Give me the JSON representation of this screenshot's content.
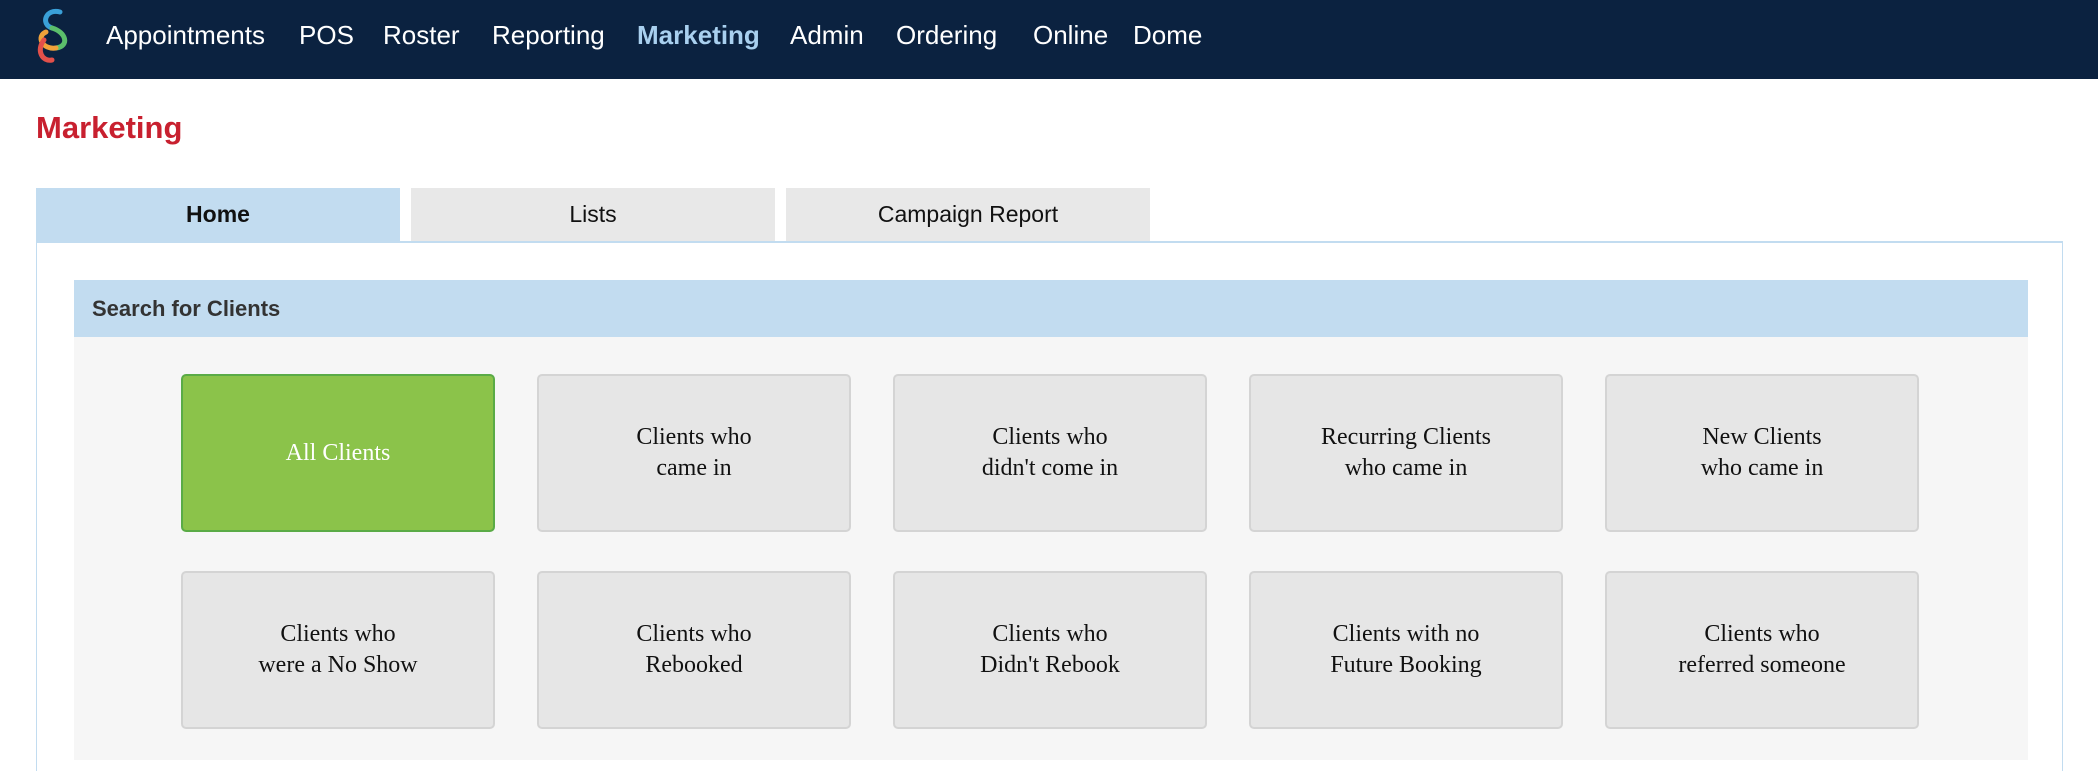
{
  "nav": {
    "items": [
      {
        "label": "Appointments"
      },
      {
        "label": "POS"
      },
      {
        "label": "Roster"
      },
      {
        "label": "Reporting"
      },
      {
        "label": "Marketing",
        "active": true
      },
      {
        "label": "Admin"
      },
      {
        "label": "Ordering"
      },
      {
        "label": "Online"
      },
      {
        "label": "Dome"
      }
    ]
  },
  "page": {
    "title": "Marketing"
  },
  "tabs": [
    {
      "label": "Home",
      "active": true
    },
    {
      "label": "Lists"
    },
    {
      "label": "Campaign Report"
    }
  ],
  "search_panel": {
    "header": "Search for Clients",
    "tiles": [
      {
        "line1": "All Clients",
        "line2": "",
        "selected": true
      },
      {
        "line1": "Clients who",
        "line2": "came in"
      },
      {
        "line1": "Clients who",
        "line2": "didn't come in"
      },
      {
        "line1": "Recurring Clients",
        "line2": "who came in"
      },
      {
        "line1": "New Clients",
        "line2": "who came in"
      },
      {
        "line1": "Clients who",
        "line2": "were a No Show"
      },
      {
        "line1": "Clients who",
        "line2": "Rebooked"
      },
      {
        "line1": "Clients who",
        "line2": "Didn't Rebook"
      },
      {
        "line1": "Clients with no",
        "line2": "Future Booking"
      },
      {
        "line1": "Clients who",
        "line2": "referred someone"
      }
    ]
  },
  "colors": {
    "nav_bg": "#0b2240",
    "accent_red": "#c8202f",
    "tab_active": "#c2dcf0",
    "tile_selected": "#8bc34a"
  }
}
